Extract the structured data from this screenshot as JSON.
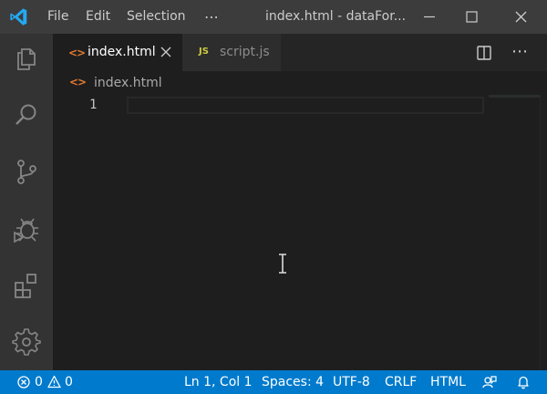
{
  "titlebar": {
    "menu": [
      "File",
      "Edit",
      "Selection",
      "⋯"
    ],
    "window_title": "index.html - dataFor..."
  },
  "activity_bar": {
    "icons": [
      "explorer-icon",
      "search-icon",
      "source-control-icon",
      "debug-icon",
      "extensions-icon",
      "settings-gear-icon"
    ]
  },
  "tabs": [
    {
      "icon_text": "<>",
      "label": "index.html",
      "active": true
    },
    {
      "icon_text": "JS",
      "label": "script.js",
      "active": false
    }
  ],
  "breadcrumb": {
    "icon_text": "<>",
    "label": "index.html"
  },
  "editor": {
    "line_numbers": [
      "1"
    ]
  },
  "statusbar": {
    "errors": "0",
    "warnings": "0",
    "position": "Ln 1, Col 1",
    "spaces": "Spaces: 4",
    "encoding": "UTF-8",
    "eol": "CRLF",
    "language": "HTML"
  },
  "colors": {
    "titlebar": "#3c3c3c",
    "activity_bar": "#333333",
    "editor_bg": "#1e1e1e",
    "statusbar": "#007acc",
    "html_icon": "#e37933",
    "js_icon": "#cbcb41",
    "vscode_logo": "#23a9f2"
  }
}
